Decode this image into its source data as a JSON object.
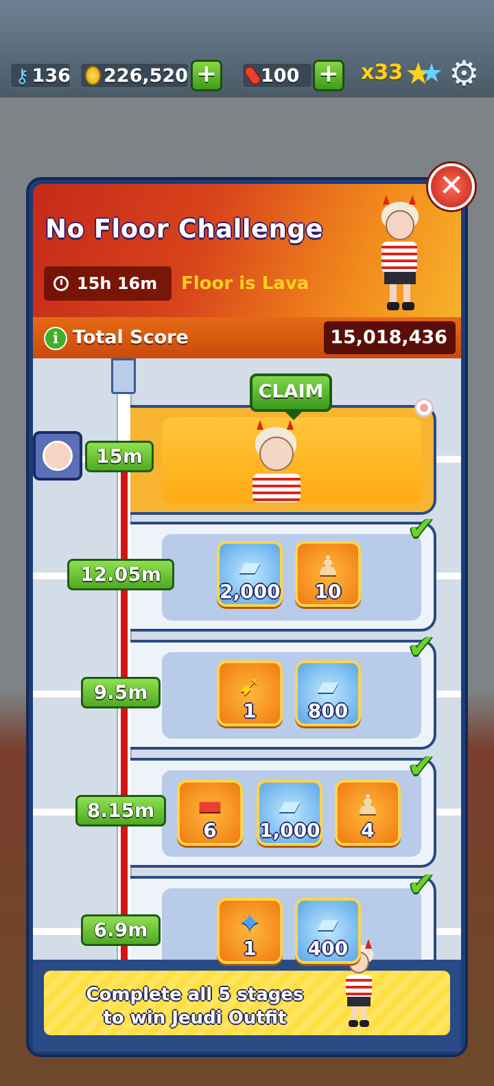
{
  "currency": {
    "keys": "136",
    "coins": "226,520",
    "hoverboards": "100",
    "multiplier": "x33"
  },
  "icons": {
    "key": "key-icon",
    "coin": "coin-icon",
    "board": "hoverboard-icon",
    "plus": "plus-icon",
    "star": "star-icon",
    "settings": "gear-icon",
    "close": "close-icon",
    "info": "info-icon",
    "check": "checkmark-icon",
    "clock": "stopwatch-icon"
  },
  "challenge": {
    "title": "No Floor Challenge",
    "timer": "15h 16m",
    "subtitle": "Floor is Lava",
    "score_label": "Total Score",
    "score_value": "15,018,436",
    "claim_label": "CLAIM",
    "footer_text_line1": "Complete all 5 stages",
    "footer_text_line2": "to win Jeudi Outfit"
  },
  "stages": [
    {
      "distance": "15m",
      "reward": "Jeudi outfit",
      "completed": false
    },
    {
      "distance": "12.05m",
      "rewards": [
        {
          "type": "hoverboard",
          "qty": "2,000"
        },
        {
          "type": "key",
          "qty": "10"
        }
      ],
      "completed": true
    },
    {
      "distance": "9.5m",
      "rewards": [
        {
          "type": "boost",
          "qty": "1"
        },
        {
          "type": "hoverboard",
          "qty": "800"
        }
      ],
      "completed": true
    },
    {
      "distance": "8.15m",
      "rewards": [
        {
          "type": "board",
          "qty": "6"
        },
        {
          "type": "hoverboard",
          "qty": "1,000"
        },
        {
          "type": "key",
          "qty": "4"
        }
      ],
      "completed": true
    },
    {
      "distance": "6.9m",
      "rewards": [
        {
          "type": "star",
          "qty": "1"
        },
        {
          "type": "hoverboard",
          "qty": "400"
        }
      ],
      "completed": true
    }
  ],
  "colors": {
    "accent_green": "#4faa22",
    "header_red": "#c52a1a",
    "score_bg": "#5b0e08",
    "footer_yellow": "#ffe044",
    "track_red": "#d41313"
  }
}
